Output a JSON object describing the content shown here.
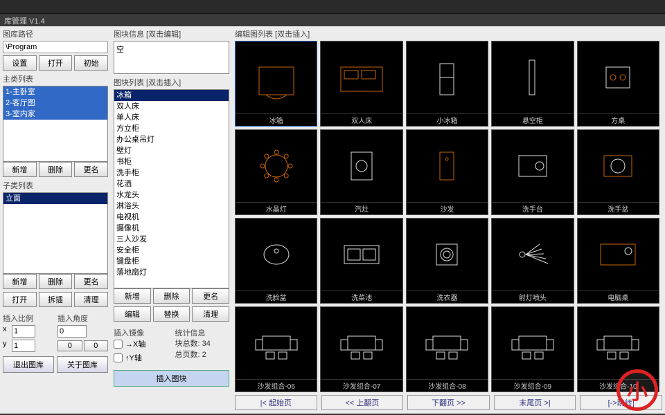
{
  "app": {
    "title": "库管理 V1.4"
  },
  "path": {
    "label": "图库路径",
    "value": "\\Program"
  },
  "pathButtons": {
    "set": "设置",
    "open": "打开",
    "init": "初始"
  },
  "dirList": {
    "label": "主类列表",
    "items": [
      "1-主卧室",
      "2-客厅图",
      "3-室内家"
    ]
  },
  "dirButtons": {
    "new": "新增",
    "del": "删除",
    "rename": "更名"
  },
  "subList": {
    "label": "子类列表",
    "items": [
      "立面"
    ]
  },
  "subButtons": {
    "new": "新增",
    "del": "删除",
    "rename": "更名",
    "open": "打开",
    "tile": "拆插",
    "clear": "清理"
  },
  "blockInfo": {
    "label": "图块信息 [双击编辑]",
    "value": "空"
  },
  "blockList": {
    "label": "图块列表 [双击插入]",
    "selected": "冰箱",
    "items": [
      "冰箱",
      "双人床",
      "单人床",
      "方立柜",
      "办公桌吊灯",
      "壁灯",
      "书柜",
      "洗手柜",
      "花洒",
      "水龙头",
      "淋浴头",
      "电视机",
      "摄像机",
      "三人沙发",
      "安全柜",
      "键盘柜",
      "落地扇灯"
    ]
  },
  "blockButtons": {
    "new": "新增",
    "del": "删除",
    "rename": "更名",
    "edit": "编辑",
    "replace": "替换",
    "clear": "清理"
  },
  "insertPanel": {
    "scaleLabel": "插入比例",
    "angleLabel": "插入角度",
    "mirrorLabel": "插入镜像",
    "xMirror": "→X轴",
    "yMirror": "↑Y轴",
    "x": "1",
    "y": "1",
    "angle": "0",
    "zero": "0"
  },
  "stats": {
    "label": "统计信息",
    "blocks": "块总数: 34",
    "pages": "总页数: 2"
  },
  "bottomButtons": {
    "exitLib": "退出图库",
    "aboutLib": "关于图库",
    "insertBlock": "插入图块"
  },
  "thumbs": {
    "label": "编辑图列表 [双击插入]",
    "items": [
      {
        "name": "冰箱",
        "sel": true
      },
      {
        "name": "双人床"
      },
      {
        "name": "小冰箱"
      },
      {
        "name": "悬空柜"
      },
      {
        "name": "方桌"
      },
      {
        "name": "水晶灯"
      },
      {
        "name": "汽灶"
      },
      {
        "name": "沙发"
      },
      {
        "name": "洗手台"
      },
      {
        "name": "洗手盆"
      },
      {
        "name": "洗脸盆"
      },
      {
        "name": "洗菜池"
      },
      {
        "name": "洗衣器"
      },
      {
        "name": "射灯喷头"
      },
      {
        "name": "电脑桌"
      },
      {
        "name": "沙发组合-06"
      },
      {
        "name": "沙发组合-07"
      },
      {
        "name": "沙发组合-08"
      },
      {
        "name": "沙发组合-09"
      },
      {
        "name": "沙发组合-10"
      }
    ]
  },
  "nav": {
    "first": "|< 起始页",
    "prev": "<< 上翻页",
    "next": "下翻页 >>",
    "last": "末尾页 >|",
    "jump": "[->跳转]"
  }
}
